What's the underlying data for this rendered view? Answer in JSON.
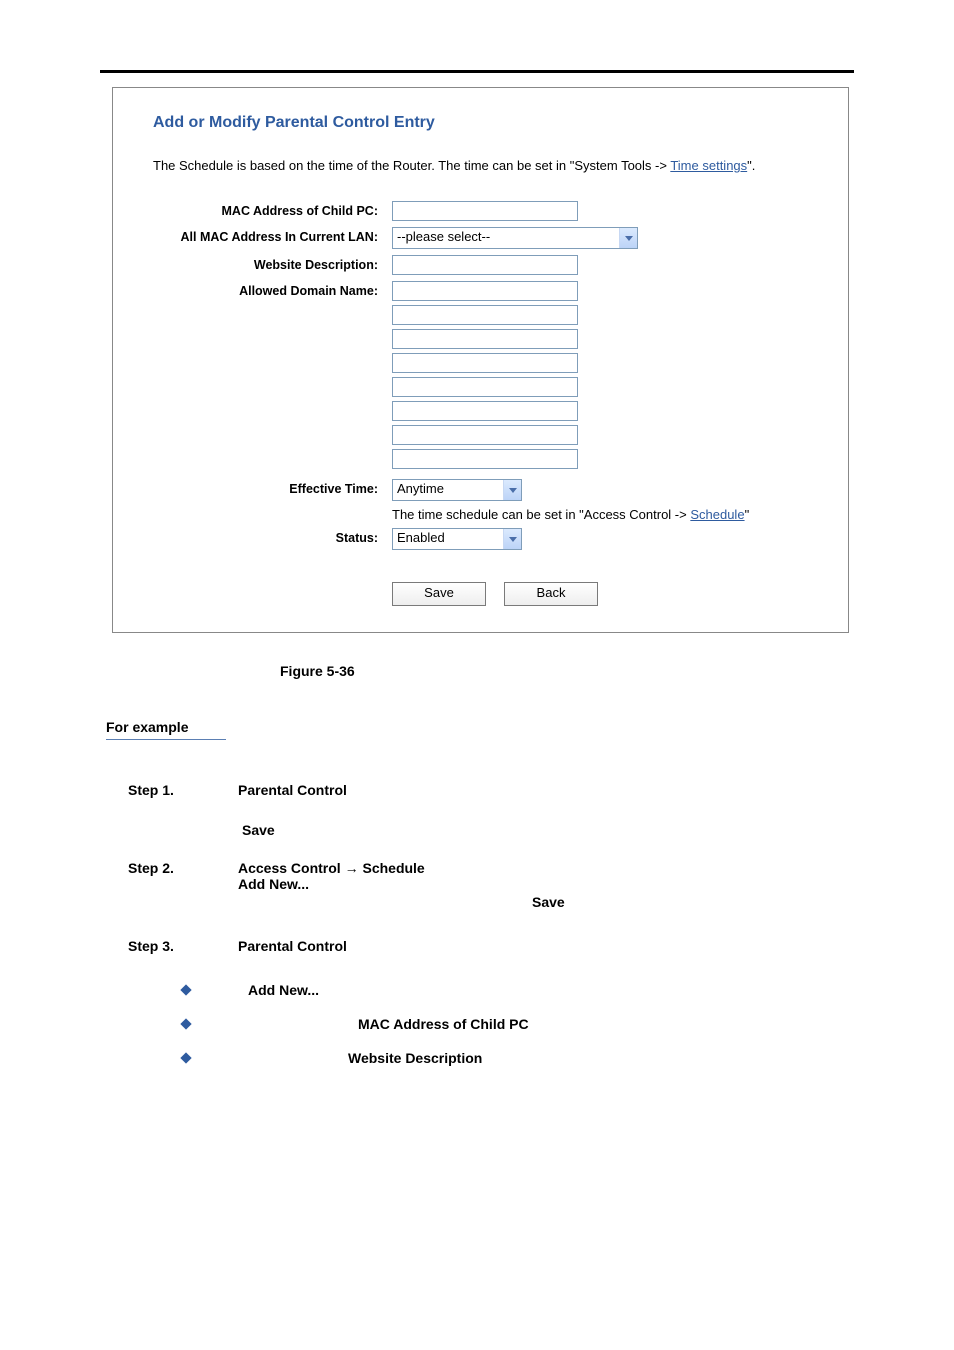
{
  "panel": {
    "title": "Add or Modify Parental Control Entry",
    "intro_prefix": "The Schedule is based on the time of the Router. The time can be set in \"System Tools -> ",
    "intro_link": "Time settings",
    "intro_suffix": "\".",
    "labels": {
      "mac_child": "MAC Address of Child PC:",
      "all_mac": "All MAC Address In Current LAN:",
      "website_desc": "Website Description:",
      "allowed_domain": "Allowed Domain Name:",
      "effective_time": "Effective Time:",
      "status": "Status:"
    },
    "fields": {
      "mac_child_value": "",
      "all_mac_selected": "--please select--",
      "website_desc_value": "",
      "domain_values": [
        "",
        "",
        "",
        "",
        "",
        "",
        "",
        ""
      ],
      "effective_time_selected": "Anytime",
      "effective_hint_prefix": "The time schedule can be set in \"Access Control -> ",
      "effective_hint_link": "Schedule",
      "effective_hint_suffix": "\"",
      "status_selected": "Enabled"
    },
    "buttons": {
      "save": "Save",
      "back": "Back"
    }
  },
  "caption": "Figure 5-36",
  "example": {
    "heading": "For  example",
    "steps": [
      {
        "label": "Step 1.",
        "text": "Parental Control",
        "trailing_save": "Save",
        "save_class": "save-inset1"
      },
      {
        "label": "Step 2.",
        "text": "Access  Control  →  Schedule\nAdd  New...",
        "trailing_save": "Save",
        "save_class": "save-inset2"
      },
      {
        "label": "Step 3.",
        "text": "Parental  Control",
        "trailing_save": "",
        "save_class": ""
      }
    ],
    "bullets": [
      {
        "text": "Add New...",
        "offset": "off1"
      },
      {
        "text": "MAC Address of Child PC",
        "offset": "off2"
      },
      {
        "text": "Website Description",
        "offset": "off3"
      }
    ]
  }
}
